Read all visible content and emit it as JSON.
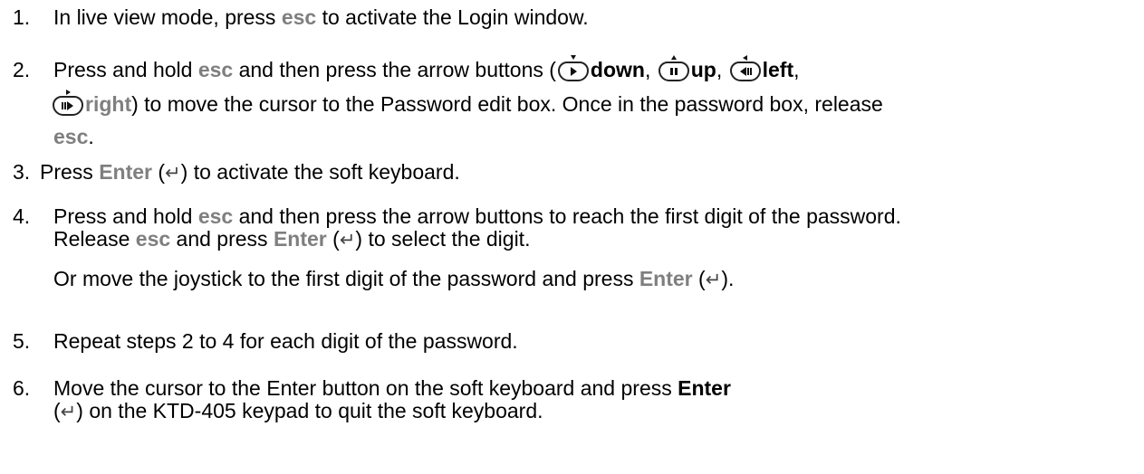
{
  "steps": [
    {
      "number": "1.",
      "lines": [
        [
          "In live view mode, press ",
          {
            "kw": "esc"
          },
          " to activate the Login window."
        ]
      ]
    },
    {
      "number": "2.",
      "line1": {
        "a": "Press and hold ",
        "kw1": "esc",
        "b": " and then press the arrow buttons (",
        "down": "down",
        "sep1": ", ",
        "up": "up",
        "sep2": ", ",
        "left": "left",
        "sep3": ","
      },
      "line2": {
        "right": "right",
        "a": ") to move the cursor to the Password edit box. Once in the password box, release"
      },
      "line3": {
        "kw": "esc",
        "a": "."
      }
    },
    {
      "number": "3.",
      "a": "Press ",
      "kw": "Enter",
      "b": " (",
      "c": ") to activate the soft keyboard."
    },
    {
      "number": "4.",
      "line1": "Press and hold ",
      "line1_kw": "esc",
      "line1_b": " and then press the arrow buttons to reach the first digit of the password.",
      "line2_a": "Release ",
      "line2_kw1": "esc",
      "line2_b": " and press ",
      "line2_kw2": "Enter",
      "line2_c": " (",
      "line2_d": ") to select the digit.",
      "line3_a": "Or move the joystick to the first digit of the password and press ",
      "line3_kw": "Enter",
      "line3_b": " (",
      "line3_c": ")."
    },
    {
      "number": "5.",
      "text": "Repeat steps 2 to 4 for each digit of the password."
    },
    {
      "number": "6.",
      "line1_a": "Move the cursor to the Enter button on the soft keyboard and press ",
      "line1_kw": "Enter",
      "line2_a": "(",
      "line2_b": ") on the KTD-405 keypad to quit the soft keyboard."
    }
  ],
  "symbols": {
    "enter": "↵"
  },
  "icons": {
    "down_button": "down-arrow-button-icon",
    "up_button": "up-arrow-button-icon",
    "left_button": "left-arrow-button-icon",
    "right_button": "right-arrow-button-icon",
    "enter": "enter-key-icon"
  },
  "colors": {
    "keyword": "#7f7f7f",
    "text": "#000000"
  }
}
